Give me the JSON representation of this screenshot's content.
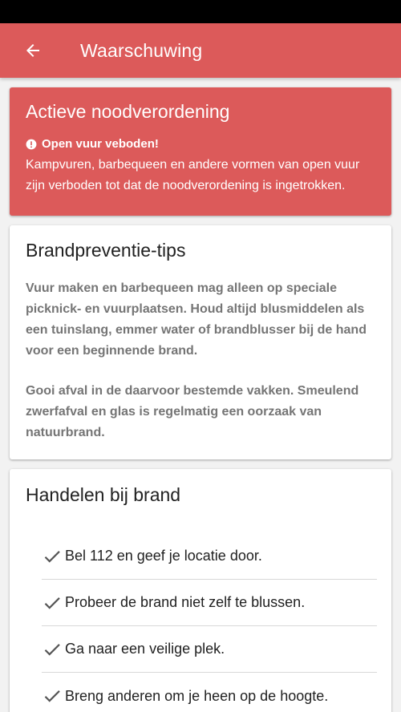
{
  "app_bar": {
    "title": "Waarschuwing",
    "back_icon": "arrow-left-icon"
  },
  "alert": {
    "title": "Actieve noodverordening",
    "subtitle": "Open vuur veboden!",
    "icon": "exclamation-circle-icon",
    "text": "Kampvuren, barbequeen en andere vormen van open vuur zijn verboden tot dat de noodverordening is ingetrokken.",
    "color": "#dc5a5a"
  },
  "tips": {
    "title": "Brandpreventie-tips",
    "paragraphs": [
      "Vuur maken en barbequeen mag alleen op speciale picknick- en vuurplaatsen. Houd altijd blusmiddelen als een tuinslang, emmer water of brandblusser bij de hand voor een beginnende brand.",
      "Gooi afval in de daarvoor bestemde vakken. Smeulend zwerfafval en glas is regelmatig een oorzaak van natuurbrand."
    ]
  },
  "handelen": {
    "title": "Handelen bij brand",
    "items": [
      "Bel 112 en geef je locatie door.",
      "Probeer de brand niet zelf te blussen.",
      "Ga naar een veilige plek.",
      "Breng anderen om je heen op de hoogte."
    ],
    "item_icon": "checkmark-icon"
  }
}
